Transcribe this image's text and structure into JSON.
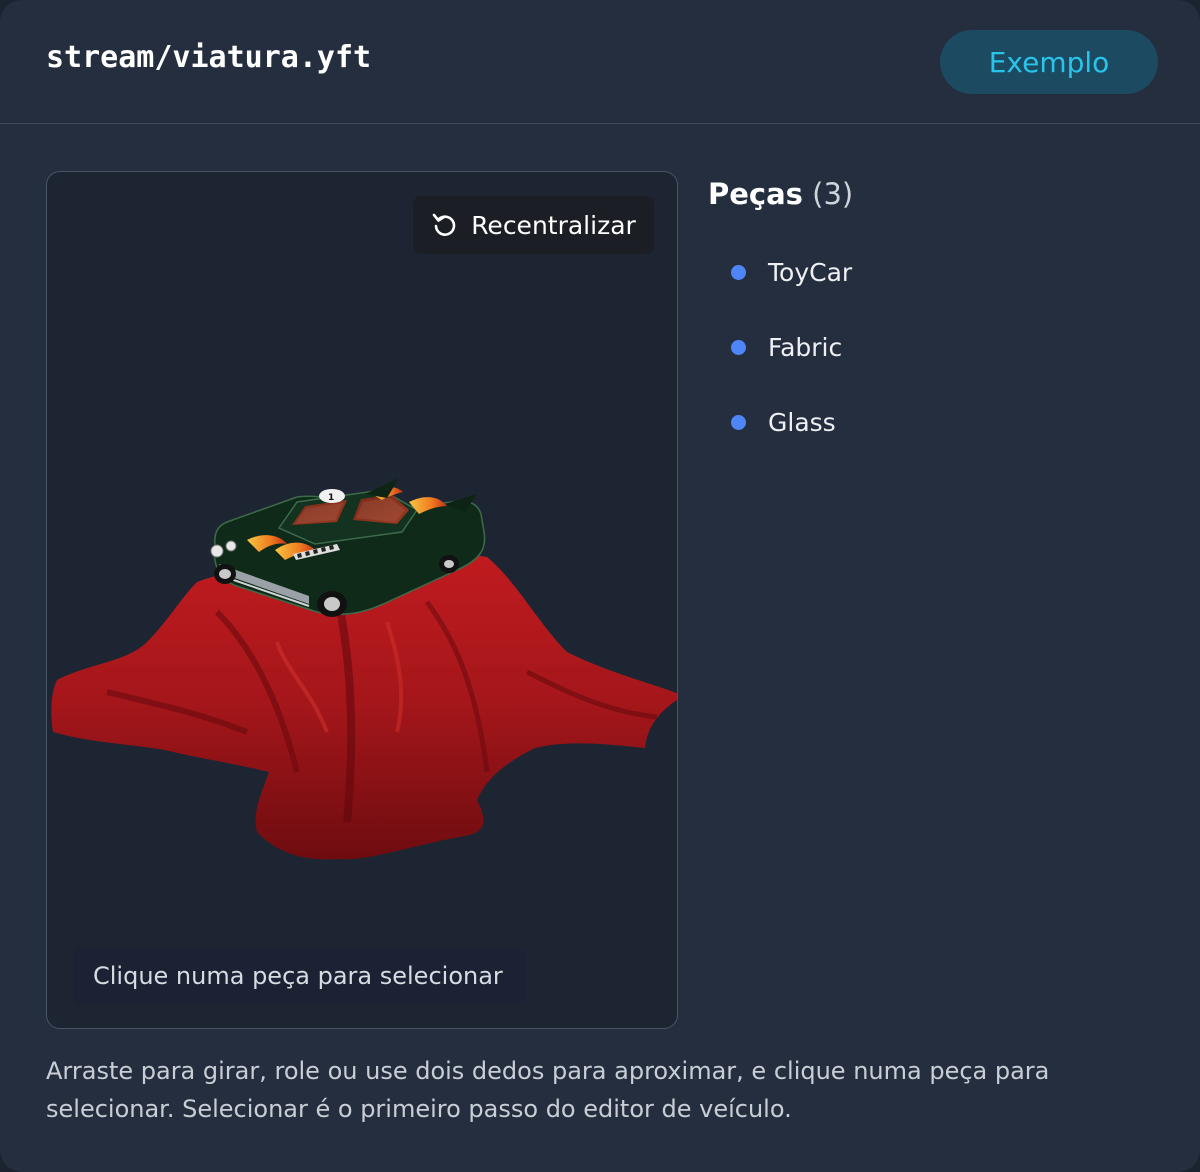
{
  "header": {
    "file_path": "stream/viatura.yft",
    "example_button": "Exemplo"
  },
  "viewer": {
    "recenter_label": "Recentralizar",
    "recenter_icon": "rotate-ccw-icon",
    "hint": "Clique numa peça para selecionar",
    "colors": {
      "fabric": "#a1181b",
      "car_body": "#10301c"
    }
  },
  "parts": {
    "title": "Peças",
    "count": "(3)",
    "items": [
      {
        "label": "ToyCar"
      },
      {
        "label": "Fabric"
      },
      {
        "label": "Glass"
      }
    ],
    "dot_color": "#4f86f7"
  },
  "footer": {
    "description": "Arraste para girar, role ou use dois dedos para aproximar, e clique numa peça para selecionar. Selecionar é o primeiro passo do editor de veículo."
  }
}
